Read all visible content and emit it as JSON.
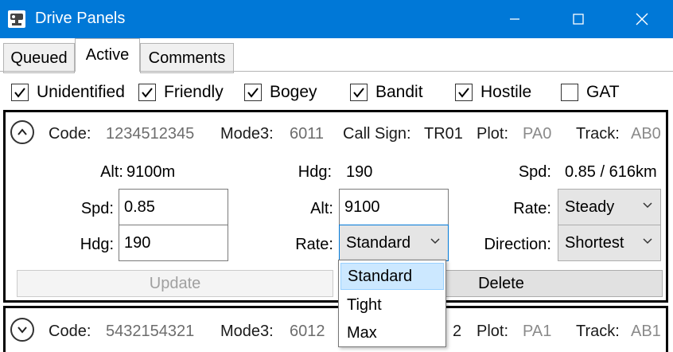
{
  "window": {
    "title": "Drive Panels",
    "icon": "satellite-dish-icon"
  },
  "tabs": [
    {
      "label": "Queued",
      "active": false
    },
    {
      "label": "Active",
      "active": true
    },
    {
      "label": "Comments",
      "active": false
    }
  ],
  "filters": [
    {
      "label": "Unidentified",
      "checked": true
    },
    {
      "label": "Friendly",
      "checked": true
    },
    {
      "label": "Bogey",
      "checked": true
    },
    {
      "label": "Bandit",
      "checked": true
    },
    {
      "label": "Hostile",
      "checked": true
    },
    {
      "label": "GAT",
      "checked": false
    }
  ],
  "panels": [
    {
      "expanded": true,
      "header": {
        "code_label": "Code:",
        "code": "1234512345",
        "mode3_label": "Mode3:",
        "mode3": "6011",
        "callsign_label": "Call Sign:",
        "callsign": "TR01",
        "plot_label": "Plot:",
        "plot": "PA0",
        "track_label": "Track:",
        "track": "AB0"
      },
      "status": {
        "alt_label": "Alt:",
        "alt": "9100m",
        "hdg_label": "Hdg:",
        "hdg": "190",
        "spd_label": "Spd:",
        "spd": "0.85 / 616km"
      },
      "controls": {
        "spd_label": "Spd:",
        "spd_value": "0.85",
        "hdg_label": "Hdg:",
        "hdg_value": "190",
        "alt_label": "Alt:",
        "alt_value": "9100",
        "rate_label": "Rate:",
        "rate_value": "Standard",
        "rate2_label": "Rate:",
        "rate2_value": "Steady",
        "direction_label": "Direction:",
        "direction_value": "Shortest"
      },
      "buttons": {
        "update": "Update",
        "delete": "Delete"
      },
      "rate_dropdown": {
        "options": [
          "Standard",
          "Tight",
          "Max"
        ],
        "selected": "Standard"
      }
    },
    {
      "expanded": false,
      "header": {
        "code_label": "Code:",
        "code": "5432154321",
        "mode3_label": "Mode3:",
        "mode3": "6012",
        "callsign_partial": "2",
        "plot_label": "Plot:",
        "plot": "PA1",
        "track_label": "Track:",
        "track": "AB1"
      }
    }
  ],
  "colors": {
    "titlebar": "#0078d7",
    "dropdown_highlight": "#cce8ff",
    "focus_border": "#0078d7"
  }
}
